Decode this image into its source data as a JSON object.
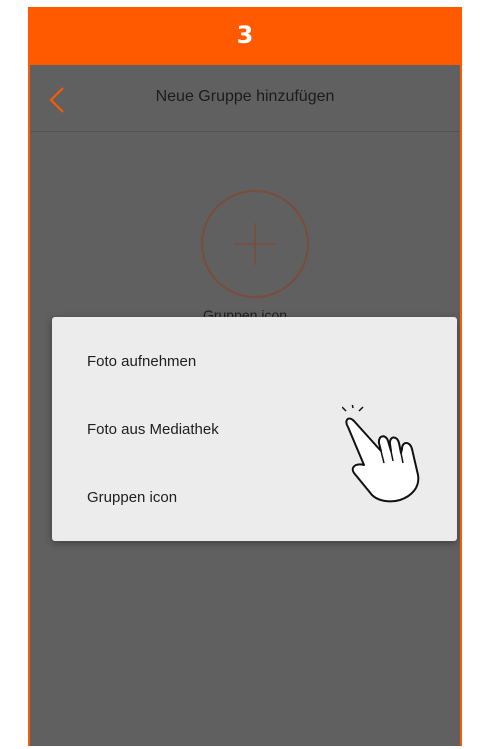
{
  "step": {
    "number": "3"
  },
  "colors": {
    "banner": "#ff5a00",
    "overlay": "#606060",
    "dialog": "#ececec",
    "back_icon": "#ff5a00"
  },
  "header": {
    "title": "Neue Gruppe hinzufügen",
    "back_icon": "chevron-left-icon"
  },
  "group_image": {
    "icon": "plus-circle-icon",
    "label": "Gruppen icon"
  },
  "dialog": {
    "items": [
      {
        "label": "Foto aufnehmen"
      },
      {
        "label": "Foto aus Mediathek"
      },
      {
        "label": "Gruppen icon"
      }
    ]
  },
  "pointer": {
    "icon": "hand-pointer-icon"
  }
}
